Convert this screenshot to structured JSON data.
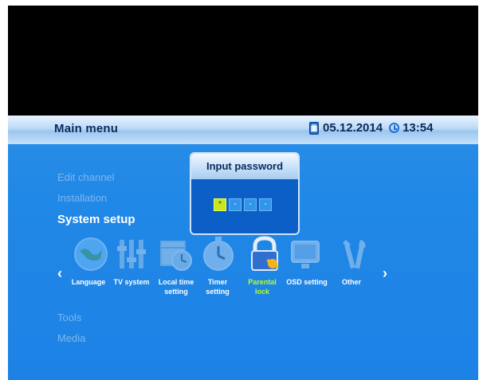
{
  "header": {
    "title": "Main menu",
    "date": "05.12.2014",
    "time": "13:54"
  },
  "menu": {
    "items": [
      {
        "label": "Edit channel"
      },
      {
        "label": "Installation"
      },
      {
        "label": "System setup"
      },
      {
        "label": "Tools"
      },
      {
        "label": "Media"
      }
    ],
    "active_index": 2
  },
  "system_setup": {
    "icons": [
      {
        "name": "globe-icon",
        "label": [
          "Language",
          ""
        ]
      },
      {
        "name": "tv-system-icon",
        "label": [
          "TV system",
          ""
        ]
      },
      {
        "name": "calendar-clock-icon",
        "label": [
          "Local time",
          "setting"
        ]
      },
      {
        "name": "timer-icon",
        "label": [
          "Timer",
          "setting"
        ]
      },
      {
        "name": "parental-lock-icon",
        "label": [
          "Parental",
          "lock"
        ]
      },
      {
        "name": "osd-setting-icon",
        "label": [
          "OSD setting",
          ""
        ]
      },
      {
        "name": "other-tools-icon",
        "label": [
          "Other",
          ""
        ]
      }
    ],
    "active_index": 4
  },
  "dialog": {
    "title": "Input password",
    "fields": [
      "*",
      "-",
      "-",
      "-"
    ],
    "active_index": 0
  },
  "arrows": {
    "left": "‹",
    "right": "›"
  },
  "colors": {
    "header_text": "#0a2a5a",
    "active_label": "#b8ff2a",
    "menu_inactive": "#7fb6ee",
    "panel_blue": "#1d82e6"
  }
}
